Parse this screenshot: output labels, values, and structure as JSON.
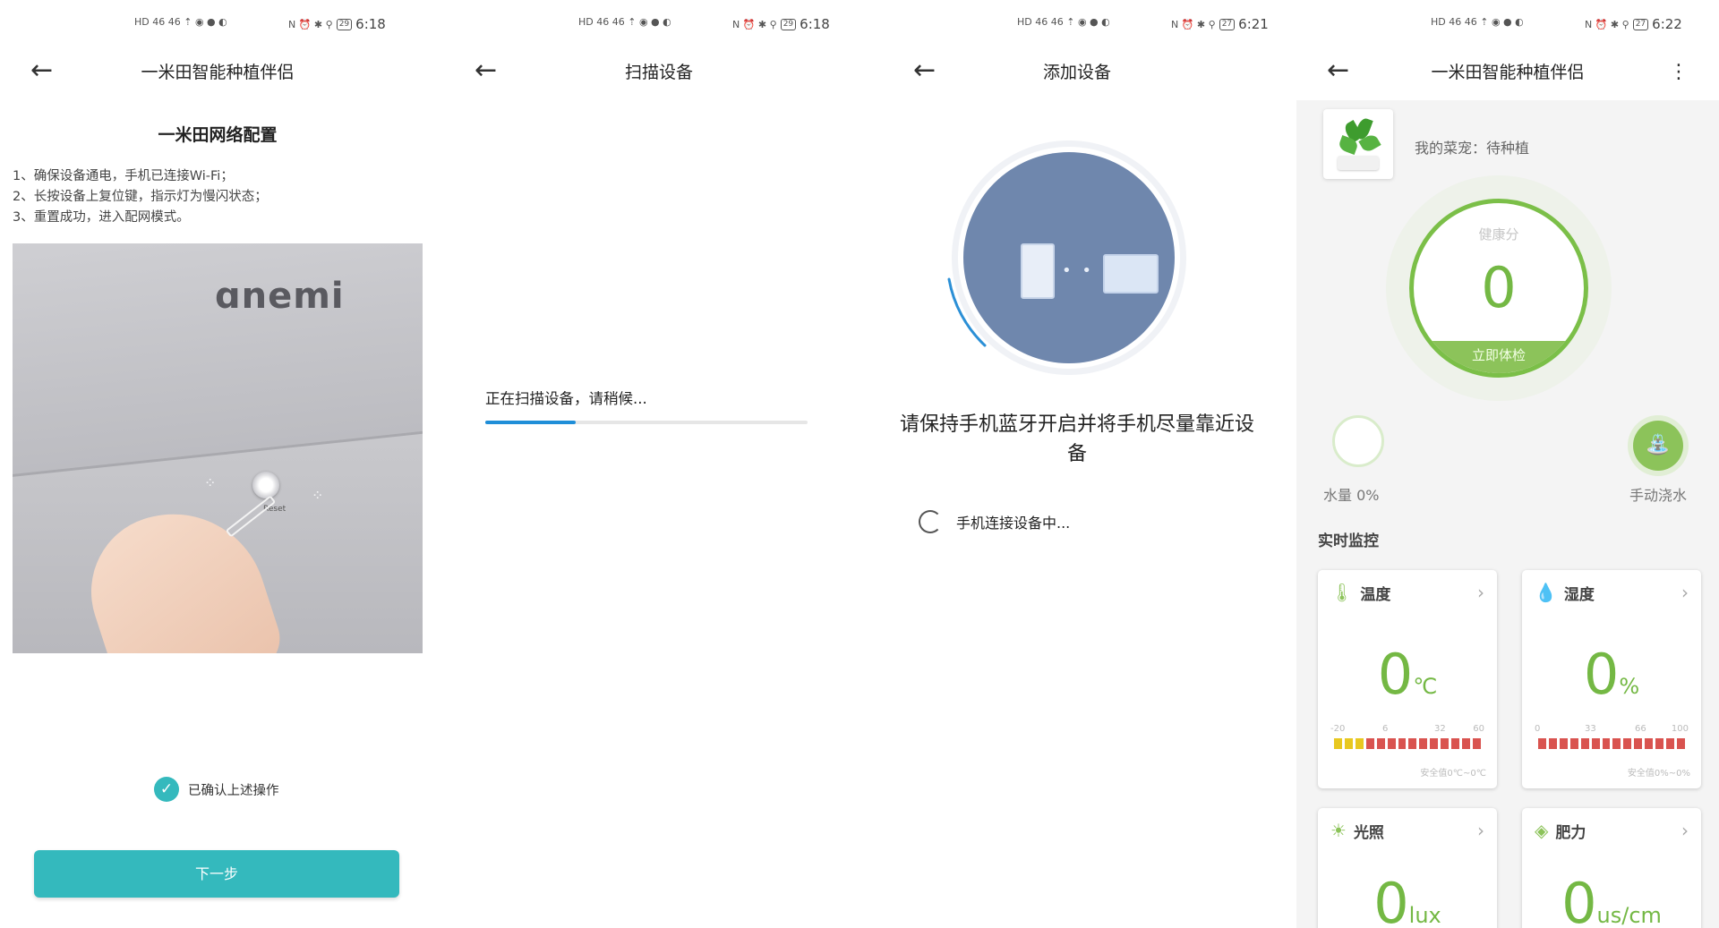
{
  "status_bars": [
    {
      "left": "HD 46 46 ⇡ ◉ ● ◐",
      "right": "N ⏰ ✱ ⚲",
      "battery": "29",
      "time": "6:18"
    },
    {
      "left": "HD 46 46 ⇡ ◉ ● ◐",
      "right": "N ⏰ ✱ ⚲",
      "battery": "29",
      "time": "6:18"
    },
    {
      "left": "HD 46 46 ⇡ ◉ ● ◐",
      "right": "N ⏰ ✱ ⚲",
      "battery": "27",
      "time": "6:21"
    },
    {
      "left": "HD 46 46 ⇡ ◉ ● ◐",
      "right": "N ⏰ ✱ ⚲",
      "battery": "27",
      "time": "6:22"
    }
  ],
  "screen1": {
    "title": "一米田智能种植伴侣",
    "heading": "一米田网络配置",
    "steps": [
      "1、确保设备通电，手机已连接Wi-Fi；",
      "2、长按设备上复位键，指示灯为慢闪状态；",
      "3、重置成功，进入配网模式。"
    ],
    "photo_brand": "ɑnemi",
    "photo_reset_label": "Reset",
    "confirm_label": "已确认上述操作",
    "next_button": "下一步"
  },
  "screen2": {
    "title": "扫描设备",
    "scan_text": "正在扫描设备，请稍候...",
    "progress": 0.28
  },
  "screen3": {
    "title": "添加设备",
    "message": "请保持手机蓝牙开启并将手机尽量靠近设备",
    "connecting": "手机连接设备中..."
  },
  "screen4": {
    "title": "一米田智能种植伴侣",
    "pet_label": "我的菜宠：待种植",
    "health_label": "健康分",
    "health_value": "0",
    "health_button": "立即体检",
    "water_label": "水量 0%",
    "pour_label": "手动浇水",
    "section_title": "实时监控",
    "cards": {
      "temperature": {
        "label": "温度",
        "value": "0",
        "unit": "℃",
        "ticks": [
          "-20",
          "6",
          "32",
          "60"
        ],
        "safe": "安全值0℃~0℃"
      },
      "humidity": {
        "label": "湿度",
        "value": "0",
        "unit": "%",
        "ticks": [
          "0",
          "33",
          "66",
          "100"
        ],
        "safe": "安全值0%~0%"
      },
      "light": {
        "label": "光照",
        "value": "0",
        "unit": "lux"
      },
      "fertility": {
        "label": "肥力",
        "value": "0",
        "unit": "us/cm"
      }
    }
  },
  "colors": {
    "accent": "#34b9bd",
    "green": "#74b844",
    "progress": "#1f8ed8",
    "bt_circle": "#6f87ad",
    "bar_yellow": "#e8c820",
    "bar_red": "#d9534f"
  },
  "icons": [
    "back-arrow-icon",
    "more-vert-icon",
    "checkmark-icon",
    "thermometer-icon",
    "droplet-icon",
    "sun-icon",
    "fertilizer-icon",
    "chevron-right-icon",
    "watering-can-icon"
  ]
}
